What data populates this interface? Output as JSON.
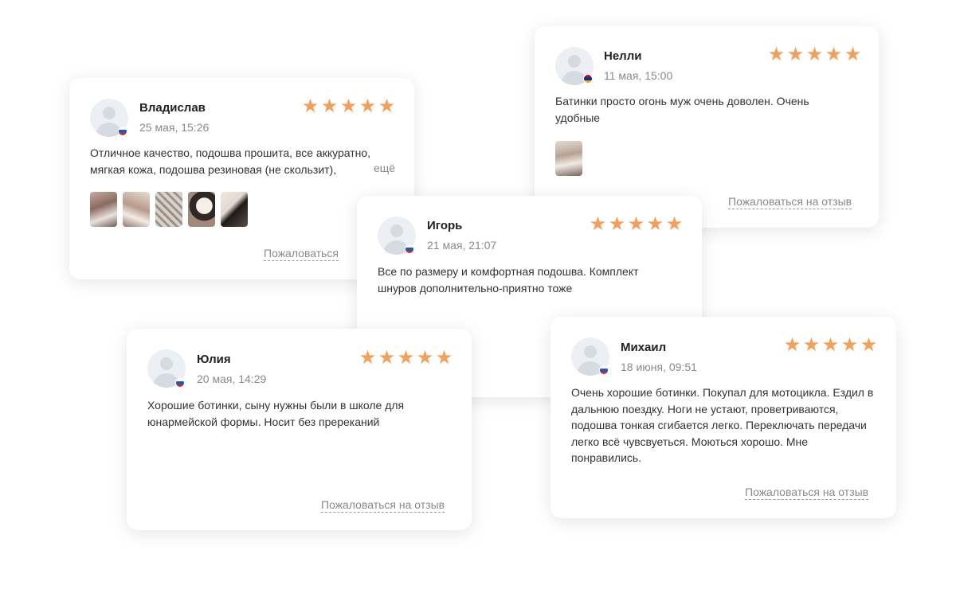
{
  "colors": {
    "star": "#F5A05A",
    "flag_ru": [
      "#ffffff",
      "#1c57c9",
      "#d52b1e"
    ],
    "flag_am": [
      "#d90012",
      "#0033a0",
      "#f2a800"
    ]
  },
  "reviews": [
    {
      "id": "vladislav",
      "name": "Владислав",
      "date": "25 мая, 15:26",
      "rating": 5,
      "flag": "flag-ru-icon",
      "text": "Отличное качество, подошва прошита, все аккуратно, мягкая кожа, подошва резиновая (не скользит),",
      "more": "ещё",
      "photos": [
        "photo-thumbnail",
        "photo-thumbnail",
        "photo-thumbnail",
        "photo-thumbnail",
        "photo-thumbnail"
      ],
      "complain": "Пожаловаться"
    },
    {
      "id": "nelli",
      "name": "Нелли",
      "date": "11 мая, 15:00",
      "rating": 5,
      "flag": "flag-am-icon",
      "text": "Батинки просто огонь муж очень доволен. Очень удобные",
      "photos": [
        "photo-thumbnail"
      ],
      "complain": "Пожаловаться на отзыв"
    },
    {
      "id": "igor",
      "name": "Игорь",
      "date": "21 мая, 21:07",
      "rating": 5,
      "flag": "flag-ru-icon",
      "text": "Все по размеру и комфортная подошва. Комплект шнуров дополнительно-приятно тоже"
    },
    {
      "id": "yulia",
      "name": "Юлия",
      "date": "20 мая, 14:29",
      "rating": 5,
      "flag": "flag-ru-icon",
      "text": "Хорошие ботинки, сыну нужны были в школе для юнармейской формы. Носит без пререканий",
      "complain": "Пожаловаться на отзыв"
    },
    {
      "id": "mikhail",
      "name": "Михаил",
      "date": "18 июня, 09:51",
      "rating": 5,
      "flag": "flag-ru-icon",
      "text": "Очень хорошие ботинки. Покупал для мотоцикла. Ездил в дальнюю поездку. Ноги не устают, проветриваются, подошва тонкая сгибается легко. Переключать передачи легко всё чувсвуеться. Моються хорошо. Мне понравились.",
      "complain": "Пожаловаться на отзыв"
    }
  ]
}
